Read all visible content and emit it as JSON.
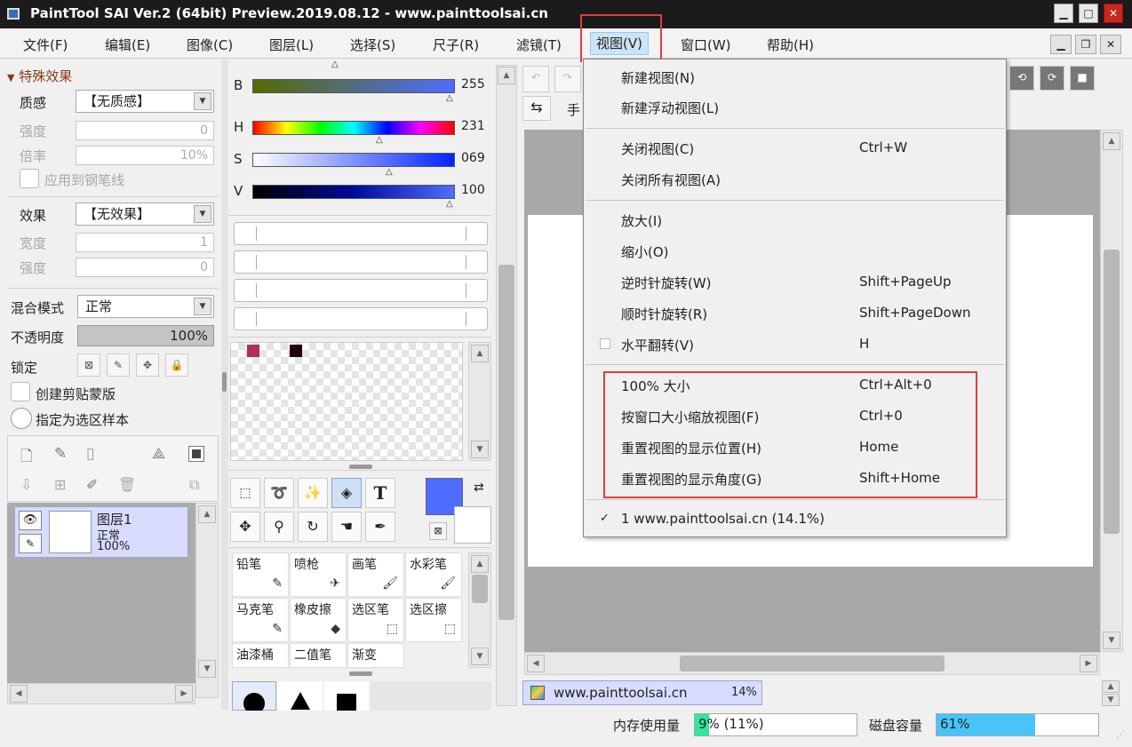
{
  "window": {
    "title": "PaintTool SAI Ver.2 (64bit) Preview.2019.08.12 - www.painttoolsai.cn"
  },
  "menubar": {
    "items": [
      "文件(F)",
      "编辑(E)",
      "图像(C)",
      "图层(L)",
      "选择(S)",
      "尺子(R)",
      "滤镜(T)",
      "视图(V)",
      "窗口(W)",
      "帮助(H)"
    ],
    "active": "视图(V)"
  },
  "effects_panel": {
    "section_title": "特殊效果",
    "texture_label": "质感",
    "texture_value": "【无质感】",
    "strength_label": "强度",
    "strength_value": "0",
    "rate_label": "倍率",
    "rate_value": "10%",
    "apply_pen_label": "应用到钢笔线",
    "effect_label": "效果",
    "effect_value": "【无效果】",
    "width_label": "宽度",
    "width_value": "1",
    "strength2_label": "强度",
    "strength2_value": "0"
  },
  "layer_props": {
    "blend_label": "混合模式",
    "blend_value": "正常",
    "opacity_label": "不透明度",
    "opacity_value": "100%",
    "lock_label": "锁定",
    "clip_label": "创建剪贴蒙版",
    "select_src_label": "指定为选区样本"
  },
  "layers": [
    {
      "name": "图层1",
      "mode": "正常",
      "opacity": "100%"
    }
  ],
  "color_sliders": [
    {
      "label": "B",
      "value": "255"
    },
    {
      "label": "H",
      "value": "231"
    },
    {
      "label": "S",
      "value": "069"
    },
    {
      "label": "V",
      "value": "100"
    }
  ],
  "swatches": [
    "#b03050",
    "#200010"
  ],
  "colors": {
    "primary": "#4f6dff",
    "menu_highlight": "#cce4f7",
    "red_box": "#e03c3c"
  },
  "tools": {
    "text_tool_glyph": "T",
    "brushes": [
      {
        "name": "铅笔"
      },
      {
        "name": "喷枪"
      },
      {
        "name": "画笔"
      },
      {
        "name": "水彩笔"
      },
      {
        "name": "马克笔"
      },
      {
        "name": "橡皮擦"
      },
      {
        "name": "选区笔"
      },
      {
        "name": "选区擦"
      },
      {
        "name": "油漆桶"
      },
      {
        "name": "二值笔"
      },
      {
        "name": "渐变"
      }
    ]
  },
  "canvas_toolbar": {
    "hand_label": "手"
  },
  "view_menu": {
    "groups": [
      [
        {
          "label": "新建视图(N)",
          "shortcut": ""
        },
        {
          "label": "新建浮动视图(L)",
          "shortcut": ""
        }
      ],
      [
        {
          "label": "关闭视图(C)",
          "shortcut": "Ctrl+W"
        },
        {
          "label": "关闭所有视图(A)",
          "shortcut": ""
        }
      ],
      [
        {
          "label": "放大(I)",
          "shortcut": ""
        },
        {
          "label": "缩小(O)",
          "shortcut": ""
        },
        {
          "label": "逆时针旋转(W)",
          "shortcut": "Shift+PageUp"
        },
        {
          "label": "顺时针旋转(R)",
          "shortcut": "Shift+PageDown"
        },
        {
          "label": "水平翻转(V)",
          "shortcut": "H"
        }
      ],
      [
        {
          "label": "100% 大小",
          "shortcut": "Ctrl+Alt+0"
        },
        {
          "label": "按窗口大小缩放视图(F)",
          "shortcut": "Ctrl+0"
        },
        {
          "label": "重置视图的显示位置(H)",
          "shortcut": "Home"
        },
        {
          "label": "重置视图的显示角度(G)",
          "shortcut": "Shift+Home"
        }
      ],
      [
        {
          "label": "1 www.painttoolsai.cn (14.1%)",
          "shortcut": ""
        }
      ]
    ]
  },
  "document_tab": {
    "name": "www.painttoolsai.cn",
    "zoom": "14%"
  },
  "status": {
    "memory_label": "内存使用量",
    "memory_value": "9% (11%)",
    "memory_fraction": 0.09,
    "disk_label": "磁盘容量",
    "disk_value": "61%",
    "disk_fraction": 0.61
  }
}
